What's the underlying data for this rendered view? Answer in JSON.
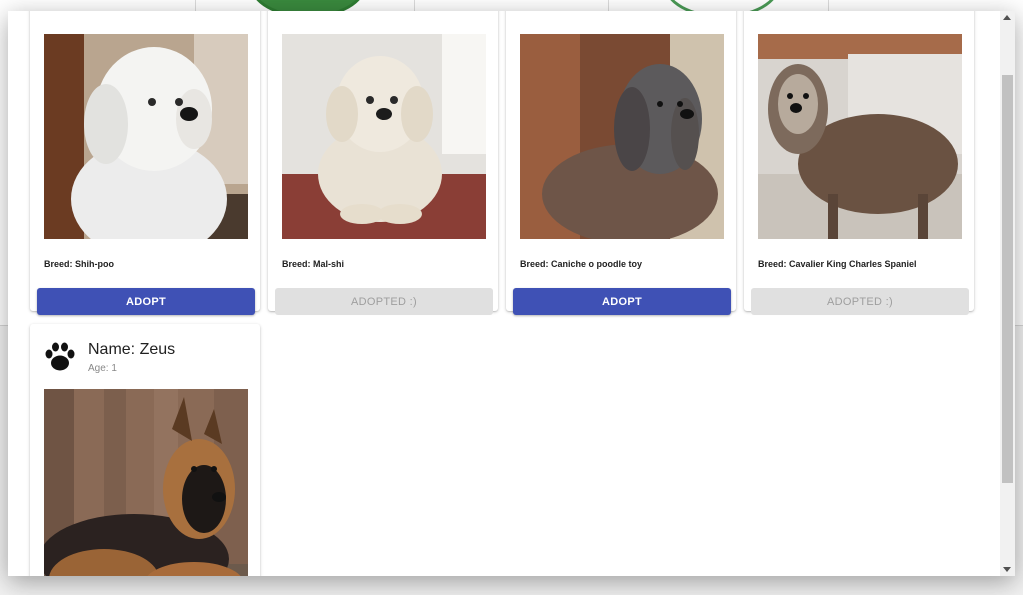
{
  "pets": [
    {
      "breed_label": "Breed: Shih-poo",
      "button_label": "ADOPT",
      "adopted": false,
      "photo": "white-fluffy-dog"
    },
    {
      "breed_label": "Breed: Mal-shi",
      "button_label": "ADOPTED :)",
      "adopted": true,
      "photo": "cream-curly-dog"
    },
    {
      "breed_label": "Breed: Caniche o poodle toy",
      "button_label": "ADOPT",
      "adopted": false,
      "photo": "grey-poodle-dog"
    },
    {
      "breed_label": "Breed: Cavalier King Charles Spaniel",
      "button_label": "ADOPTED :)",
      "adopted": true,
      "photo": "shaggy-brown-dog"
    }
  ],
  "next_pet": {
    "name_label": "Name: Zeus",
    "age_label": "Age: 1",
    "icon": "paw-icon",
    "photo": "german-shepherd-dog"
  },
  "colors": {
    "primary_button": "#3f51b5",
    "disabled_button": "#e0e0e0",
    "disabled_text": "#9e9e9e"
  }
}
